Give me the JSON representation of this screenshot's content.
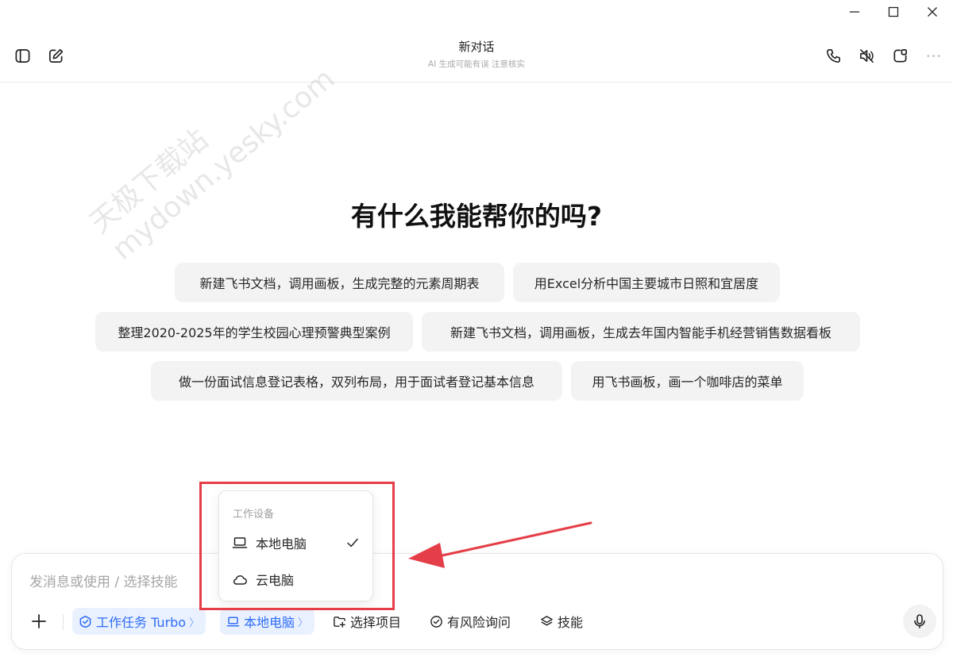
{
  "window": {
    "minimize": "minimize",
    "maximize": "maximize",
    "close": "close"
  },
  "header": {
    "title": "新对话",
    "subtitle": "AI 生成可能有误 注意核实"
  },
  "watermark": {
    "line1": "天极下载站",
    "line2": "mydown.yesky.com"
  },
  "main": {
    "heading": "有什么我能帮你的吗?",
    "suggestions": [
      "新建飞书文档，调用画板，生成完整的元素周期表",
      "用Excel分析中国主要城市日照和宜居度",
      "整理2020-2025年的学生校园心理预警典型案例",
      "新建飞书文档，调用画板，生成去年国内智能手机经营销售数据看板",
      "做一份面试信息登记表格，双列布局，用于面试者登记基本信息",
      "用飞书画板，画一个咖啡店的菜单"
    ]
  },
  "composer": {
    "placeholder": "发消息或使用 / 选择技能",
    "task_mode": "工作任务 Turbo",
    "device": "本地电脑",
    "select_project": "选择项目",
    "risk_ask": "有风险询问",
    "skills": "技能",
    "chevron": "〉"
  },
  "dropdown": {
    "heading": "工作设备",
    "items": [
      {
        "label": "本地电脑",
        "selected": true
      },
      {
        "label": "云电脑",
        "selected": false
      }
    ]
  },
  "colors": {
    "accent": "#2f6df6",
    "annotation_red": "#e53e48",
    "chip_bg": "#f3f3f3"
  }
}
